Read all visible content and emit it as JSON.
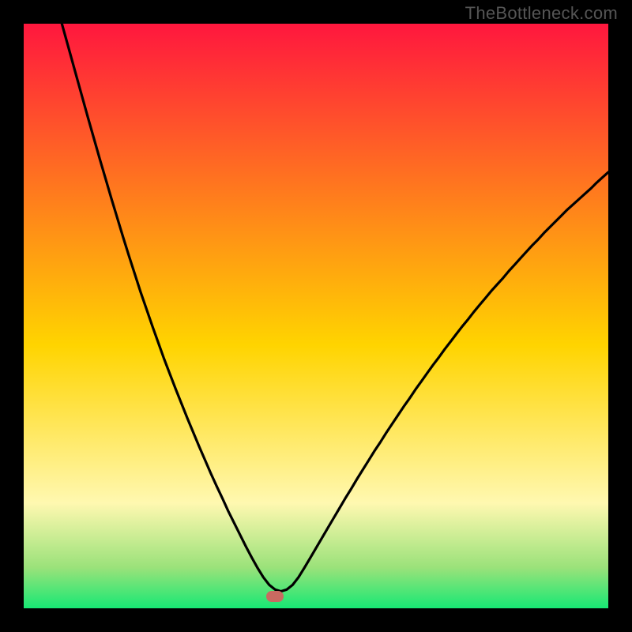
{
  "watermark": "TheBottleneck.com",
  "colors": {
    "frame": "#000000",
    "grad_top": "#ff173e",
    "grad_mid": "#ffd400",
    "grad_low": "#fff8b0",
    "grad_band": "#9be27a",
    "grad_bottom": "#17e874",
    "curve": "#000000",
    "marker": "#c96a61"
  },
  "chart_data": {
    "type": "line",
    "title": "",
    "xlabel": "",
    "ylabel": "",
    "xlim": [
      0,
      100
    ],
    "ylim": [
      0,
      100
    ],
    "marker": {
      "x": 43,
      "y": 2
    },
    "x": [
      0,
      1,
      2,
      3,
      4,
      5,
      6,
      7,
      8,
      9,
      10,
      11,
      12,
      13,
      14,
      15,
      16,
      17,
      18,
      19,
      20,
      21,
      22,
      23,
      24,
      25,
      26,
      27,
      28,
      29,
      30,
      31,
      32,
      33,
      34,
      35,
      36,
      37,
      38,
      39,
      40,
      41,
      42,
      43,
      44,
      45,
      46,
      47,
      48,
      49,
      50,
      51,
      52,
      53,
      54,
      55,
      56,
      57,
      58,
      59,
      60,
      61,
      62,
      63,
      64,
      65,
      66,
      67,
      68,
      69,
      70,
      71,
      72,
      73,
      74,
      75,
      76,
      77,
      78,
      79,
      80,
      81,
      82,
      83,
      84,
      85,
      86,
      87,
      88,
      89,
      90,
      91,
      92,
      93,
      94,
      95,
      96,
      97,
      98,
      99,
      100
    ],
    "y": [
      124.2,
      120.4,
      116.6,
      112.9,
      109.2,
      105.6,
      101.9,
      98.3,
      94.7,
      91.1,
      87.5,
      83.9,
      80.4,
      76.9,
      73.5,
      70.1,
      66.8,
      63.5,
      60.3,
      57.2,
      54.1,
      51.2,
      48.3,
      45.5,
      42.7,
      40.1,
      37.5,
      35.0,
      32.5,
      30.1,
      27.7,
      25.4,
      23.1,
      20.9,
      18.8,
      16.6,
      14.6,
      12.6,
      10.6,
      8.7,
      6.9,
      5.3,
      4.0,
      3.2,
      2.9,
      3.2,
      4.0,
      5.3,
      6.9,
      8.6,
      10.3,
      12.0,
      13.7,
      15.4,
      17.1,
      18.8,
      20.4,
      22.1,
      23.7,
      25.3,
      26.9,
      28.4,
      30.0,
      31.5,
      33.0,
      34.5,
      35.9,
      37.4,
      38.8,
      40.2,
      41.6,
      42.9,
      44.3,
      45.6,
      46.9,
      48.2,
      49.4,
      50.7,
      51.9,
      53.1,
      54.3,
      55.4,
      56.5,
      57.7,
      58.8,
      59.9,
      61.0,
      62.1,
      63.1,
      64.2,
      65.2,
      66.2,
      67.2,
      68.2,
      69.1,
      70.0,
      70.9,
      71.8,
      72.8,
      73.7,
      74.6
    ]
  }
}
